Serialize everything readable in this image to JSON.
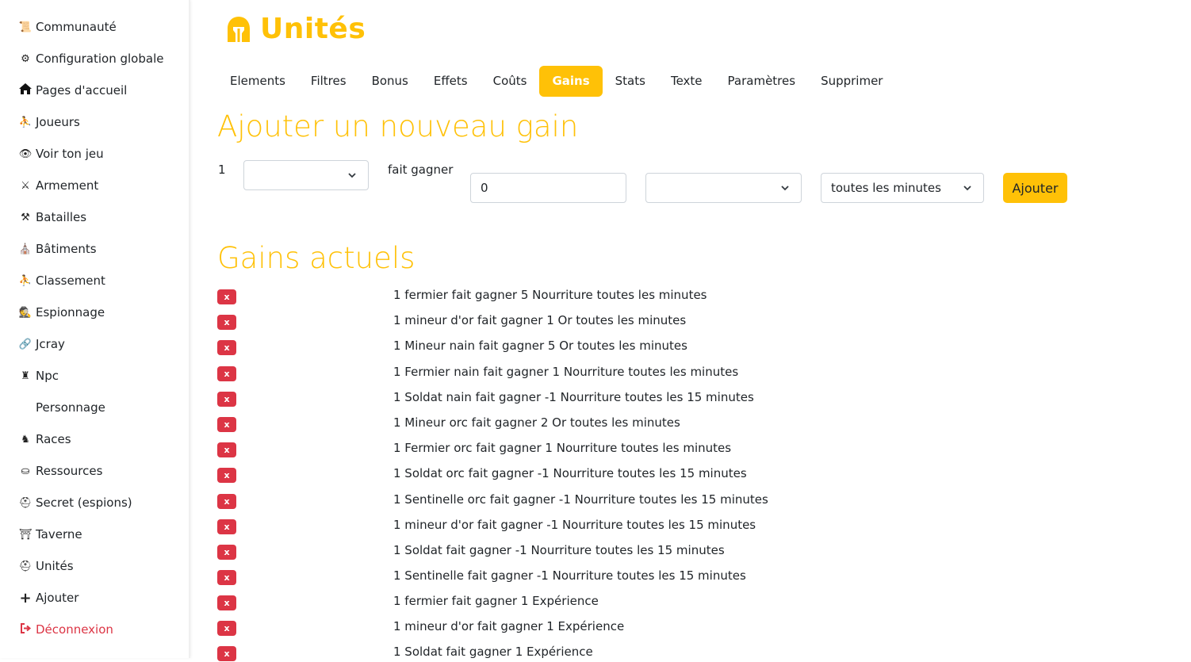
{
  "sidebar": {
    "items": [
      {
        "label": "Communauté",
        "icon": "scroll-icon"
      },
      {
        "label": "Configuration globale",
        "icon": "gear-horse-icon"
      },
      {
        "label": "Pages d'accueil",
        "icon": "home-icon"
      },
      {
        "label": "Joueurs",
        "icon": "people-icon"
      },
      {
        "label": "Voir ton jeu",
        "icon": "eye-icon"
      },
      {
        "label": "Armement",
        "icon": "weapons-icon"
      },
      {
        "label": "Batailles",
        "icon": "battle-icon"
      },
      {
        "label": "Bâtiments",
        "icon": "building-icon"
      },
      {
        "label": "Classement",
        "icon": "ranking-icon"
      },
      {
        "label": "Espionnage",
        "icon": "spy-icon"
      },
      {
        "label": "Jcray",
        "icon": "link-icon"
      },
      {
        "label": "Npc",
        "icon": "npc-icon"
      },
      {
        "label": "Personnage",
        "icon": ""
      },
      {
        "label": "Races",
        "icon": "races-icon"
      },
      {
        "label": "Ressources",
        "icon": "resources-icon"
      },
      {
        "label": "Secret (espions)",
        "icon": "helmet-icon"
      },
      {
        "label": "Taverne",
        "icon": "tavern-icon"
      },
      {
        "label": "Unités",
        "icon": "helmet-icon"
      },
      {
        "label": "Ajouter",
        "icon": "plus-icon"
      },
      {
        "label": "Déconnexion",
        "icon": "logout-icon"
      }
    ]
  },
  "header": {
    "title": "Unités",
    "icon": "spartan-helmet-icon",
    "accent": "#ffc107"
  },
  "tabs": [
    {
      "label": "Elements"
    },
    {
      "label": "Filtres"
    },
    {
      "label": "Bonus"
    },
    {
      "label": "Effets"
    },
    {
      "label": "Coûts"
    },
    {
      "label": "Gains",
      "active": true
    },
    {
      "label": "Stats"
    },
    {
      "label": "Texte"
    },
    {
      "label": "Paramètres"
    },
    {
      "label": "Supprimer"
    }
  ],
  "form": {
    "heading": "Ajouter un nouveau gain",
    "quantity_label": "1",
    "unit_select_value": "",
    "gives_label": "fait gagner",
    "amount_value": "0",
    "resource_select_value": "",
    "frequency_select_value": "toutes les minutes",
    "submit_label": "Ajouter"
  },
  "gains": {
    "heading": "Gains actuels",
    "delete_label": "x",
    "delete_color": "#dc3545",
    "items": [
      "1 fermier fait gagner 5 Nourriture toutes les minutes",
      "1 mineur d'or fait gagner 1 Or toutes les minutes",
      "1 Mineur nain fait gagner 5 Or toutes les minutes",
      "1 Fermier nain fait gagner 1 Nourriture toutes les minutes",
      "1 Soldat nain fait gagner -1 Nourriture toutes les 15 minutes",
      "1 Mineur orc fait gagner 2 Or toutes les minutes",
      "1 Fermier orc fait gagner 1 Nourriture toutes les minutes",
      "1 Soldat orc fait gagner -1 Nourriture toutes les 15 minutes",
      "1 Sentinelle orc fait gagner -1 Nourriture toutes les 15 minutes",
      "1 mineur d'or fait gagner -1 Nourriture toutes les 15 minutes",
      "1 Soldat fait gagner -1 Nourriture toutes les 15 minutes",
      "1 Sentinelle fait gagner -1 Nourriture toutes les 15 minutes",
      "1 fermier fait gagner 1 Expérience",
      "1 mineur d'or fait gagner 1 Expérience",
      "1 Soldat fait gagner 1 Expérience"
    ]
  }
}
